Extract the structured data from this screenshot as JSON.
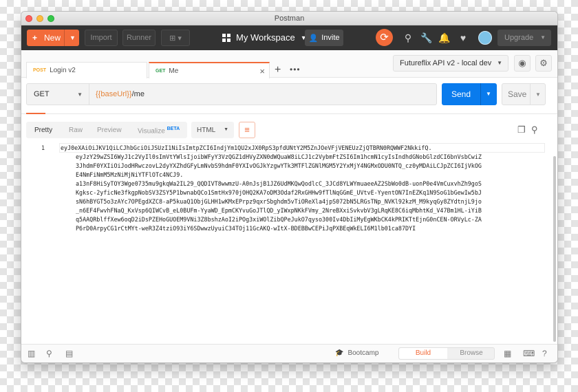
{
  "window": {
    "title": "Postman"
  },
  "header": {
    "new_label": "New",
    "import_label": "Import",
    "runner_label": "Runner",
    "workspace_label": "My Workspace",
    "invite_label": "Invite",
    "upgrade_label": "Upgrade"
  },
  "tabs": [
    {
      "method": "POST",
      "name": "Login v2",
      "method_color": "#f5a623"
    },
    {
      "method": "GET",
      "name": "Me",
      "method_color": "#2e9e4d"
    }
  ],
  "environment": {
    "selected": "Futureflix API v2 - local dev"
  },
  "request": {
    "method": "GET",
    "url_variable": "{{baseUrl}}",
    "url_path": "/me",
    "send_label": "Send",
    "save_label": "Save"
  },
  "response": {
    "views": [
      "Pretty",
      "Raw",
      "Preview",
      "Visualize"
    ],
    "beta_badge": "BETA",
    "format": "HTML",
    "line_number": "1",
    "body_lines": [
      "eyJ0eXAiOiJKV1QiLCJhbGciOiJSUzI1NiIsImtpZCI6IndjYm1QU2xJX0RpS3pfdUNtY2M5ZnJOeVFjVENEUzZjQTBRN0RQWWF2NkkifQ.",
      "eyJzY29wZSI6WyJ1c2VyIl0sImVtYWlsIjoibWFyY3VzQGZ1dHVyZXN0dWQuaW8iLCJ1c2VybmFtZSI6Im1hcmN1cyIsIndhdGNobGlzdCI6bnVsbCwiZ",
      "3JhdmF0YXIiOiJodHRwczovL2dyYXZhdGFyLmNvbS9hdmF0YXIvOGJkYzgwYTk3MTFlZGNlMGM5Y2YxMjY4NGMxODU0NTQ_cz0yMDAiLCJpZCI6IjVkOG",
      "E4NmFiNmM5MzNiMjNiYTFlOTc4NCJ9.",
      "a13nF8HiSyTOY3Wge0735mu9gkqWa2IL29_QQDIVT8wwmzU-A0nJsjB1JZ6UdMKQwQodlcC_3JCd8YLWYmuaeeAZ2SbWo0dB-uonP0e4VmCuxvhZh9goS",
      "Kgksc-2yficNe3fkgpNobSV3ZSY5P1bwnabQCo1SmtHx970jOHQ2KA7oDM3Odaf2RxGHHw9fTlNqGGmE_UVtvE-YyentON7InEZKq1N9SoG1bGewIw5bJ",
      "sN6hBYGT5o3zAYc7OPEgdXZC8-aP5kuaQ1ObjGLHH1wKMxEPrpz9qxrSbghdm5vTiOReXla4jpS072bN5LRGsTNp_NVKl92kzM_M9kyqGy8ZYdtnjL9jo",
      "_n6EF4FwvhFNaQ_KxVsp6QIWCvB_eL0BUFm-YyaWD_EpmCKYvuGoJTlQD_yIWxpNKkFVmy_2NreBXxiSvkvbV3gLRqKE8C6iqMbhtKd_V47Bm1HL-iYiB",
      "q5AAQRblffXew6oqD2iDsPZEHoGUOEM9VNi3Z8bshzAoI2iPOg3xiWOlZibQPeJukO7qyso300Iv4DbIiMyEgWKbCK4kPRIKTtEjnG0nCEN-ORVyLc-ZA",
      "P6rD0ArpyCG1rCtMYt-weR3Z4tziO93iY6SDwwzUyuiC34TOj11GcAKQ-wItX-BDEBBwCEPiJqPXBEqWkELI6M1lb01ca87DYI"
    ]
  },
  "statusbar": {
    "bootcamp_label": "Bootcamp",
    "build_label": "Build",
    "browse_label": "Browse"
  },
  "colors": {
    "accent": "#f26b3a",
    "send_blue": "#097bed",
    "header_bg": "#333333"
  }
}
